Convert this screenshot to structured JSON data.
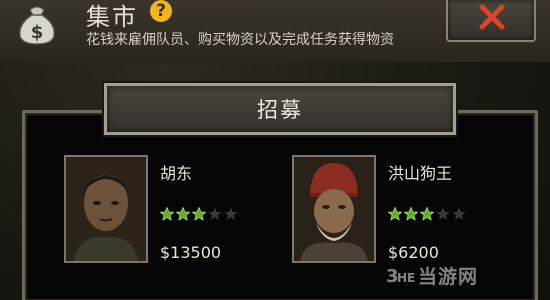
{
  "header": {
    "title": "集市",
    "help_symbol": "?",
    "subtitle": "花钱来雇佣队员、购买物资以及完成任务获得物资",
    "money_icon": "money-bag-icon",
    "close_icon": "close-x-icon"
  },
  "tabs": [
    {
      "label": "招募",
      "active": true
    }
  ],
  "recruits": [
    {
      "name": "胡东",
      "stars_filled": 3,
      "stars_total": 5,
      "price": "$13500"
    },
    {
      "name": "洪山狗王",
      "stars_filled": 3,
      "stars_total": 5,
      "price": "$6200"
    }
  ],
  "watermark": {
    "text": "当游网"
  },
  "colors": {
    "star_filled": "#5fae1e",
    "star_empty": "#3a3a38",
    "help_badge": "#f2b51e",
    "close_x": "#d9442c"
  }
}
